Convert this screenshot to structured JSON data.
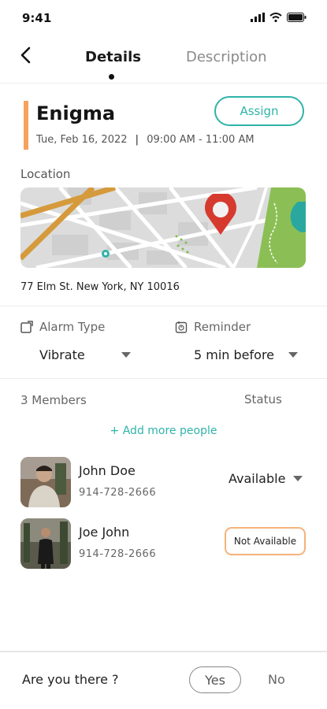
{
  "status_bar": {
    "time": "9:41"
  },
  "nav": {
    "tab_details": "Details",
    "tab_description": "Description"
  },
  "event": {
    "title": "Enigma",
    "date": "Tue, Feb 16, 2022",
    "separator": "|",
    "time": "09:00 AM - 11:00 AM",
    "assign_label": "Assign",
    "accent_color": "#f5a35c"
  },
  "location": {
    "label": "Location",
    "address": "77 Elm St. New York, NY 10016"
  },
  "alarm": {
    "label": "Alarm Type",
    "value": "Vibrate"
  },
  "reminder": {
    "label": "Reminder",
    "value": "5 min before"
  },
  "members": {
    "count_label": "3 Members",
    "status_label": "Status",
    "add_more_label": "+ Add more people",
    "list": [
      {
        "name": "John Doe",
        "phone": "914-728-2666",
        "status": "Available"
      },
      {
        "name": "Joe John",
        "phone": "914-728-2666",
        "status": "Not Available"
      }
    ]
  },
  "footer": {
    "question": "Are you there ?",
    "yes_label": "Yes",
    "no_label": "No"
  },
  "colors": {
    "teal": "#2fb3a8",
    "orange": "#f5a35c",
    "pin": "#d63a2f"
  },
  "icons": [
    "signal-icon",
    "wifi-icon",
    "battery-icon",
    "back-chevron-icon",
    "map-pin-icon",
    "alarm-icon",
    "reminder-icon",
    "caret-down-icon"
  ]
}
